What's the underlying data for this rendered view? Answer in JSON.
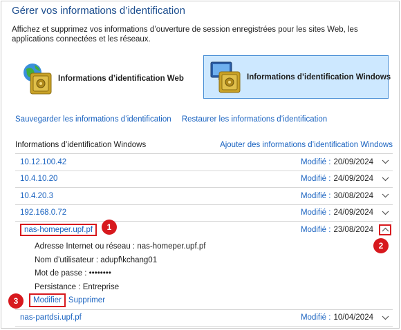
{
  "header": {
    "title": "Gérer vos informations d’identification",
    "description": "Affichez et supprimez vos informations d’ouverture de session enregistrées pour les sites Web, les applications connectées et les réseaux."
  },
  "types": {
    "web_label": "Informations d’identification Web",
    "windows_label": "Informations d’identification Windows"
  },
  "links": {
    "backup": "Sauvegarder les informations d’identification",
    "restore": "Restaurer les informations d’identification"
  },
  "section": {
    "title": "Informations d’identification Windows",
    "add_link": "Ajouter des informations d’identification Windows"
  },
  "credentials": [
    {
      "name": "10.12.100.42",
      "modified_label": "Modifié :",
      "date": "20/09/2024"
    },
    {
      "name": "10.4.10.20",
      "modified_label": "Modifié :",
      "date": "24/09/2024"
    },
    {
      "name": "10.4.20.3",
      "modified_label": "Modifié :",
      "date": "30/08/2024"
    },
    {
      "name": "192.168.0.72",
      "modified_label": "Modifié :",
      "date": "24/09/2024"
    }
  ],
  "expanded": {
    "name": "nas-homeper.upf.pf",
    "modified_label": "Modifié :",
    "date": "23/08/2024",
    "address_label": "Adresse Internet ou réseau :",
    "address_value": "nas-homeper.upf.pf",
    "user_label": "Nom d’utilisateur :",
    "user_value": "adupf\\kchang01",
    "password_label": "Mot de passe :",
    "password_value": "••••••••",
    "persistence_label": "Persistance :",
    "persistence_value": "Entreprise",
    "modify_button": "Modifier",
    "delete_button": "Supprimer"
  },
  "last": {
    "name": "nas-partdsi.upf.pf",
    "modified_label": "Modifié :",
    "date": "10/04/2024"
  },
  "callouts": {
    "one": "1",
    "two": "2",
    "three": "3"
  },
  "colors": {
    "accent": "#1a63c0",
    "title": "#1e4f8f",
    "callout": "#d7191e",
    "selected_bg": "#cde8ff"
  },
  "icons": {
    "web": "globe-safe-icon",
    "windows": "computer-safe-icon",
    "chevron_down": "chevron-down-icon",
    "chevron_up": "chevron-up-icon"
  }
}
